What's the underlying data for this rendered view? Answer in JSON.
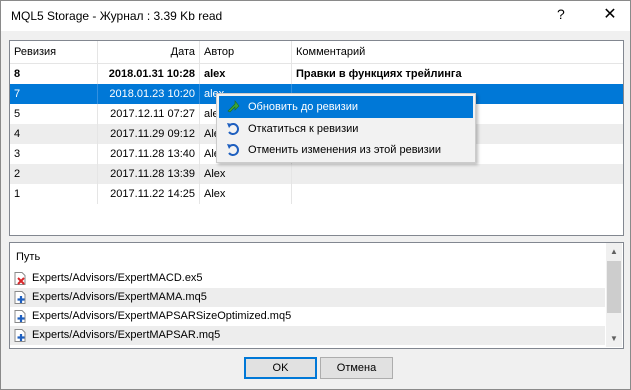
{
  "window": {
    "title": "MQL5 Storage - Журнал : 3.39 Kb read",
    "help_glyph": "?",
    "close_glyph": "✕"
  },
  "grid": {
    "columns": [
      "Ревизия",
      "Дата",
      "Автор",
      "Комментарий"
    ],
    "rows": [
      {
        "rev": "8",
        "date": "2018.01.31 10:28",
        "author": "alex",
        "comment": "Правки в функциях трейлинга"
      },
      {
        "rev": "7",
        "date": "2018.01.23 10:20",
        "author": "alex",
        "comment": ""
      },
      {
        "rev": "5",
        "date": "2017.12.11 07:27",
        "author": "alex",
        "comment": ""
      },
      {
        "rev": "4",
        "date": "2017.11.29 09:12",
        "author": "Alex",
        "comment": ""
      },
      {
        "rev": "3",
        "date": "2017.11.28 13:40",
        "author": "Alex",
        "comment": ""
      },
      {
        "rev": "2",
        "date": "2017.11.28 13:39",
        "author": "Alex",
        "comment": ""
      },
      {
        "rev": "1",
        "date": "2017.11.22 14:25",
        "author": "Alex",
        "comment": ""
      }
    ]
  },
  "context_menu": {
    "items": [
      {
        "label": "Обновить до ревизии",
        "icon": "update-arrow-icon"
      },
      {
        "label": "Откатиться к ревизии",
        "icon": "revert-arrow-icon"
      },
      {
        "label": "Отменить изменения из этой ревизии",
        "icon": "revert-arrow-icon"
      }
    ]
  },
  "paths": {
    "header": "Путь",
    "items": [
      {
        "path": "Experts/Advisors/ExpertMACD.ex5",
        "status": "deleted"
      },
      {
        "path": "Experts/Advisors/ExpertMAMA.mq5",
        "status": "added"
      },
      {
        "path": "Experts/Advisors/ExpertMAPSARSizeOptimized.mq5",
        "status": "added"
      },
      {
        "path": "Experts/Advisors/ExpertMAPSAR.mq5",
        "status": "added"
      }
    ]
  },
  "buttons": {
    "ok": "OK",
    "cancel": "Отмена"
  },
  "colors": {
    "selection": "#0078d7",
    "deleted": "#d9262a",
    "added": "#1e5fbf",
    "update": "#3aa53a"
  }
}
